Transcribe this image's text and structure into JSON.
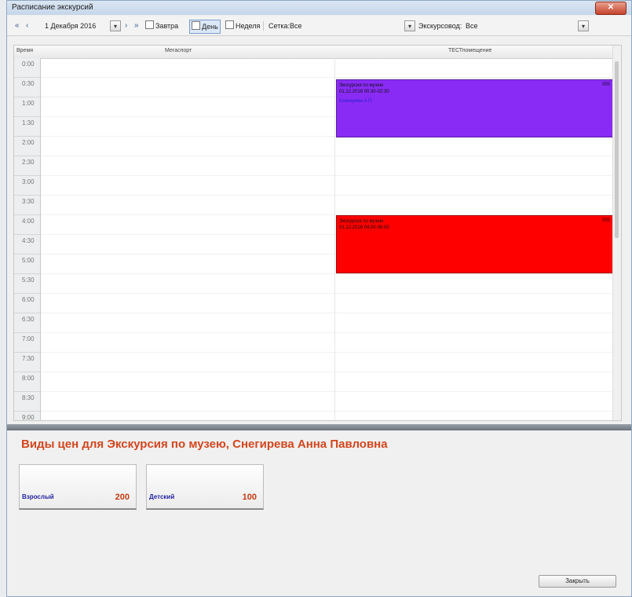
{
  "window": {
    "title": "Расписание экскурсий",
    "close_glyph": "✕"
  },
  "toolbar": {
    "nav_first": "«",
    "nav_prev": "‹",
    "date": "1 Декабря 2016",
    "nav_next": "›",
    "nav_last": "»",
    "tomorrow": "Завтра",
    "day": "День",
    "week": "Неделя",
    "grid_label": "Сетка:",
    "grid_value": "Все",
    "guide_label": "Экскурсовод:",
    "guide_value": "Все",
    "dropdown_glyph": "▾"
  },
  "schedule": {
    "col_time": "Время",
    "col_a": "Мегаспорт",
    "col_b": "ТЕСТпомещение",
    "times": [
      "0:00",
      "0:30",
      "1:00",
      "1:30",
      "2:00",
      "2:30",
      "3:00",
      "3:30",
      "4:00",
      "4:30",
      "5:00",
      "5:30",
      "6:00",
      "6:30",
      "7:00",
      "7:30",
      "8:00",
      "8:30",
      "9:00"
    ],
    "events": [
      {
        "color": "#8a2bf5",
        "line1": "Экскурсия по музею",
        "line2": "01.12.2016 00:30-02:30",
        "line3": "Снегирева А.П."
      },
      {
        "color": "#ff0000",
        "line1": "Экскурсия по музею",
        "line2": "01.12.2016 04:00-06:00",
        "line3": ""
      }
    ]
  },
  "prices": {
    "title": "Виды цен для  Экскурсия по музею, Снегирева Анна Павловна",
    "items": [
      {
        "name": "Взрослый",
        "price": "200"
      },
      {
        "name": "Детский",
        "price": "100"
      }
    ]
  },
  "footer": {
    "close_label": "Закрыть"
  }
}
